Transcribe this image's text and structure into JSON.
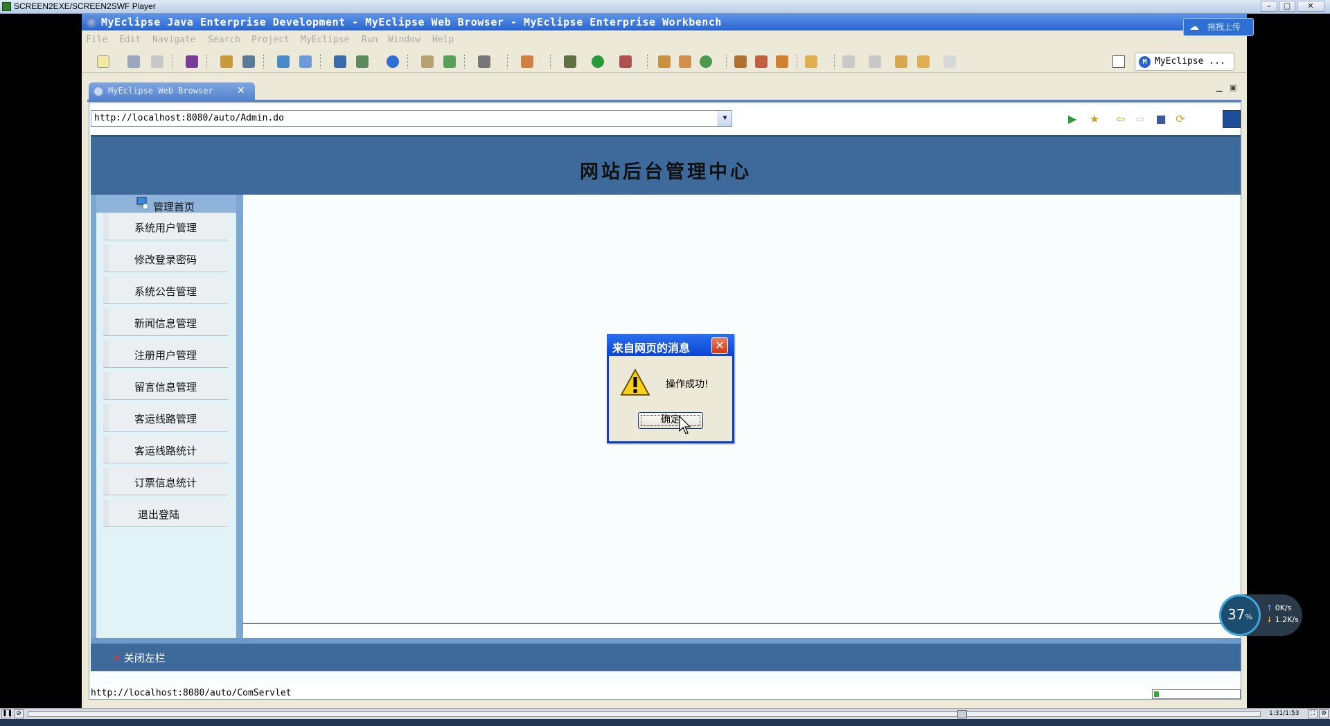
{
  "player": {
    "title": "SCREEN2EXE/SCREEN2SWF Player",
    "time": "1:31/1:53",
    "seek_progress": 0.76
  },
  "eclipse": {
    "title": "MyEclipse Java Enterprise Development - MyEclipse Web Browser - MyEclipse Enterprise Workbench",
    "upload_label": "拖拽上传",
    "menu": [
      "File",
      "Edit",
      "Navigate",
      "Search",
      "Project",
      "MyEclipse",
      "Run",
      "Window",
      "Help"
    ],
    "perspective": "MyEclipse ...",
    "editor_tab": "MyEclipse Web Browser"
  },
  "browser": {
    "address": "http://localhost:8080/auto/Admin.do",
    "status_url": "http://localhost:8080/auto/ComServlet",
    "load_progress": 0.06
  },
  "page": {
    "title": "网站后台管理中心",
    "sidebar_head": "管理首页",
    "sidebar_items": [
      "系统用户管理",
      "修改登录密码",
      "系统公告管理",
      "新闻信息管理",
      "注册用户管理",
      "留言信息管理",
      "客运线路管理",
      "客运线路统计",
      "订票信息统计",
      "退出登陆"
    ],
    "close_sidebar": "关闭左栏"
  },
  "dialog": {
    "title": "来自网页的消息",
    "message": "操作成功!",
    "ok_label": "确定"
  },
  "netmeter": {
    "percent": "37",
    "percent_unit": "%",
    "up": "0K/s",
    "down": "1.2K/s"
  },
  "colors": {
    "header_blue": "#3d6a9a",
    "dialog_title": "#0a45d2",
    "sidebar_bg": "#e2f3f8"
  }
}
